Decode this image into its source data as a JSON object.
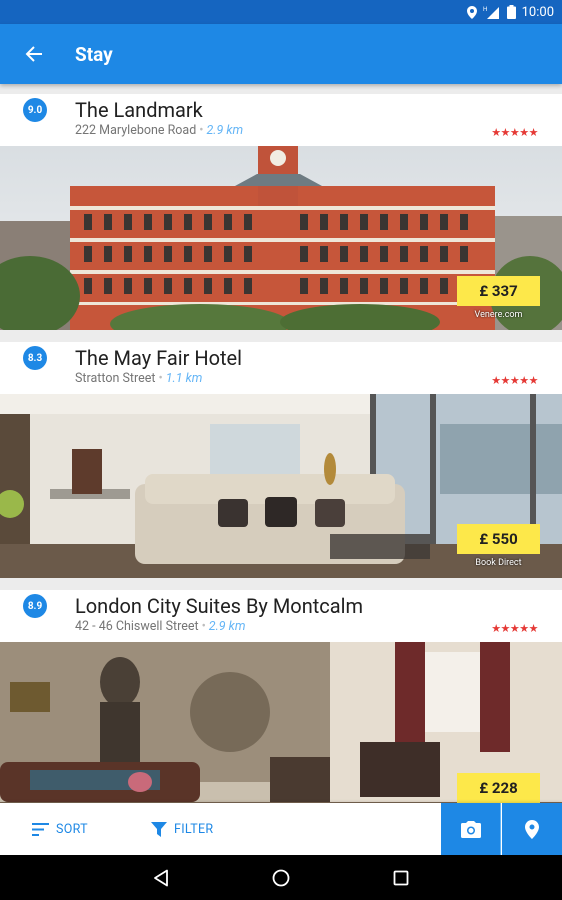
{
  "status_bar": {
    "time": "10:00",
    "network": "H"
  },
  "app_bar": {
    "title": "Stay"
  },
  "hotels": [
    {
      "rating": "9.0",
      "name": "The Landmark",
      "address": "222 Marylebone Road",
      "distance": "2.9 km",
      "stars": "★★★★★",
      "price": "£ 337",
      "source": "Venere.com"
    },
    {
      "rating": "8.3",
      "name": "The May Fair Hotel",
      "address": "Stratton Street",
      "distance": "1.1 km",
      "stars": "★★★★★",
      "price": "£ 550",
      "source": "Book Direct"
    },
    {
      "rating": "8.9",
      "name": "London City Suites By Montcalm",
      "address": "42 - 46 Chiswell Street",
      "distance": "2.9 km",
      "stars": "★★★★★",
      "price": "£ 228",
      "source": ""
    }
  ],
  "bottom_bar": {
    "sort_label": "SORT",
    "filter_label": "FILTER"
  },
  "colors": {
    "primary": "#1e88e5",
    "status": "#1565c0",
    "price_tag": "#fde84a",
    "stars": "#e53935"
  },
  "icons": {
    "back": "arrow-left-icon",
    "sort": "sort-icon",
    "filter": "filter-icon",
    "camera": "camera-icon",
    "map": "map-pin-icon"
  }
}
